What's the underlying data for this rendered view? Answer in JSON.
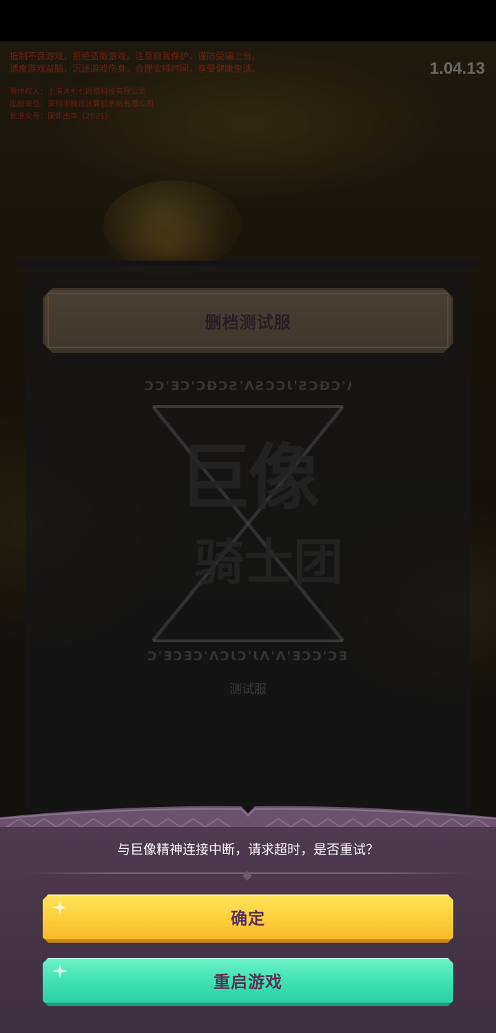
{
  "notice": {
    "lines": [
      "抵制不良游戏，拒绝盗版游戏。注意自我保护，谨防受骗上当。",
      "适度游戏益脑，沉迷游戏伤身。合理安排时间，享受健康生活。"
    ]
  },
  "company": {
    "lines": [
      "著作权人：上海沐七七网络科技有限公司",
      "出版单位：深圳市腾讯计算机系统有限公司",
      "批准文号：国新出审〔2021〕"
    ]
  },
  "version": "1.04.13",
  "server_panel": {
    "server_label": "删档测试服"
  },
  "logo": {
    "title_line1": "巨像",
    "title_line2": "骑士团",
    "subtitle": "测试服",
    "rune_top": "ƆƆ'ƎƆ'ƆƉƆƧ'ΛƧƆƆƖ'ƧƆƉƆ'Λ",
    "rune_bottom": "Ɔ'ƎƆƎƆ'ΛƆƖƆ'ƖΛ'Λ'ƎƆƆ'ƆƎ"
  },
  "dialog": {
    "message": "与巨像精神连接中断，请求超时，是否重试？",
    "confirm_label": "确定",
    "restart_label": "重启游戏"
  },
  "colors": {
    "confirm_button": "#ffd23e",
    "restart_button": "#43e2b4",
    "dialog_bg": "#4a374b",
    "button_text": "#5a2f52"
  }
}
